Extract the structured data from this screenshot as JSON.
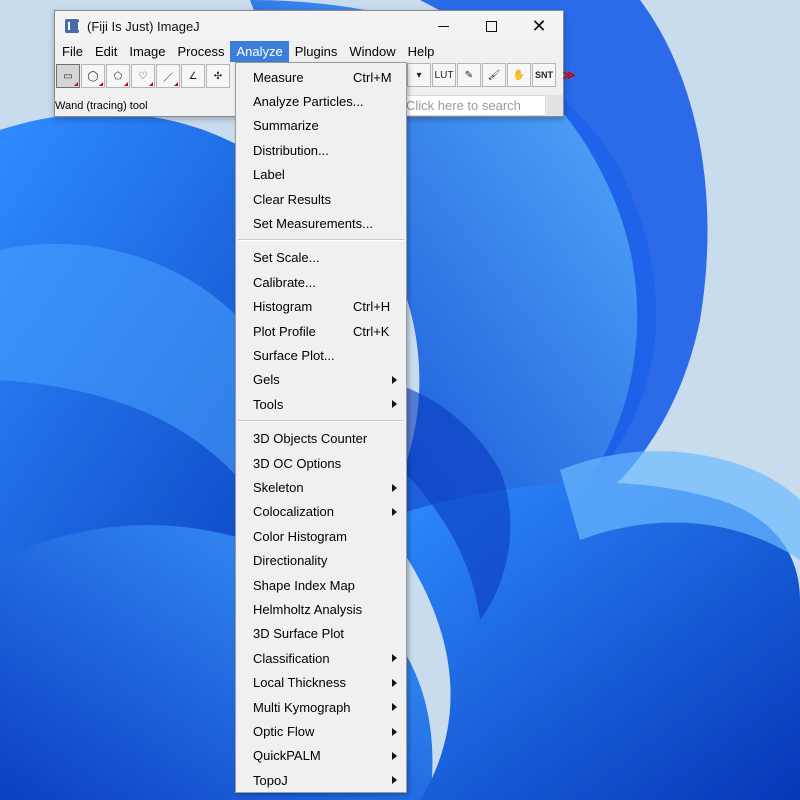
{
  "window": {
    "title": "(Fiji Is Just) ImageJ",
    "controls": {
      "minimize": "minimize",
      "maximize": "maximize",
      "close": "✕"
    }
  },
  "menubar": {
    "items": [
      "File",
      "Edit",
      "Image",
      "Process",
      "Analyze",
      "Plugins",
      "Window",
      "Help"
    ],
    "active": "Analyze"
  },
  "toolbar": {
    "tools": [
      {
        "name": "rectangle-tool",
        "glyph": "▭"
      },
      {
        "name": "oval-tool",
        "glyph": "◯"
      },
      {
        "name": "polygon-tool",
        "glyph": "⬠"
      },
      {
        "name": "freehand-tool",
        "glyph": "♡"
      },
      {
        "name": "line-tool",
        "glyph": "／"
      },
      {
        "name": "angle-tool",
        "glyph": "∠"
      },
      {
        "name": "point-tool",
        "glyph": "✣"
      }
    ],
    "right_tools": [
      {
        "name": "dropdown-tool",
        "glyph": "▾"
      },
      {
        "name": "lut-tool",
        "glyph": "LUT"
      },
      {
        "name": "pencil-tool",
        "glyph": "✎"
      },
      {
        "name": "brush-tool",
        "glyph": "🖌"
      },
      {
        "name": "flood-fill-tool",
        "glyph": "✋"
      },
      {
        "name": "snt-tool",
        "glyph": "SNT"
      },
      {
        "name": "more-tools",
        "glyph": "≫"
      }
    ]
  },
  "status": {
    "text": "Wand (tracing) tool",
    "search_placeholder": "Click here to search"
  },
  "analyze_menu": {
    "groups": [
      [
        {
          "label": "Measure",
          "shortcut": "Ctrl+M"
        },
        {
          "label": "Analyze Particles..."
        },
        {
          "label": "Summarize"
        },
        {
          "label": "Distribution..."
        },
        {
          "label": "Label"
        },
        {
          "label": "Clear Results"
        },
        {
          "label": "Set Measurements..."
        }
      ],
      [
        {
          "label": "Set Scale..."
        },
        {
          "label": "Calibrate..."
        },
        {
          "label": "Histogram",
          "shortcut": "Ctrl+H"
        },
        {
          "label": "Plot Profile",
          "shortcut": "Ctrl+K"
        },
        {
          "label": "Surface Plot..."
        },
        {
          "label": "Gels",
          "submenu": true
        },
        {
          "label": "Tools",
          "submenu": true
        }
      ],
      [
        {
          "label": "3D Objects Counter"
        },
        {
          "label": "3D OC Options"
        },
        {
          "label": "Skeleton",
          "submenu": true
        },
        {
          "label": "Colocalization",
          "submenu": true
        },
        {
          "label": "Color Histogram"
        },
        {
          "label": "Directionality"
        },
        {
          "label": "Shape Index Map"
        },
        {
          "label": "Helmholtz Analysis"
        },
        {
          "label": "3D Surface Plot"
        },
        {
          "label": "Classification",
          "submenu": true
        },
        {
          "label": "Local Thickness",
          "submenu": true
        },
        {
          "label": "Multi Kymograph",
          "submenu": true
        },
        {
          "label": "Optic Flow",
          "submenu": true
        },
        {
          "label": "QuickPALM",
          "submenu": true
        },
        {
          "label": "TopoJ",
          "submenu": true
        }
      ]
    ]
  },
  "colors": {
    "accent": "#3b7fd9",
    "wallpaper_bg": "#c7dbee",
    "wallpaper_blue_dark": "#0a3fc8",
    "wallpaper_blue_light": "#3aa0ff"
  }
}
